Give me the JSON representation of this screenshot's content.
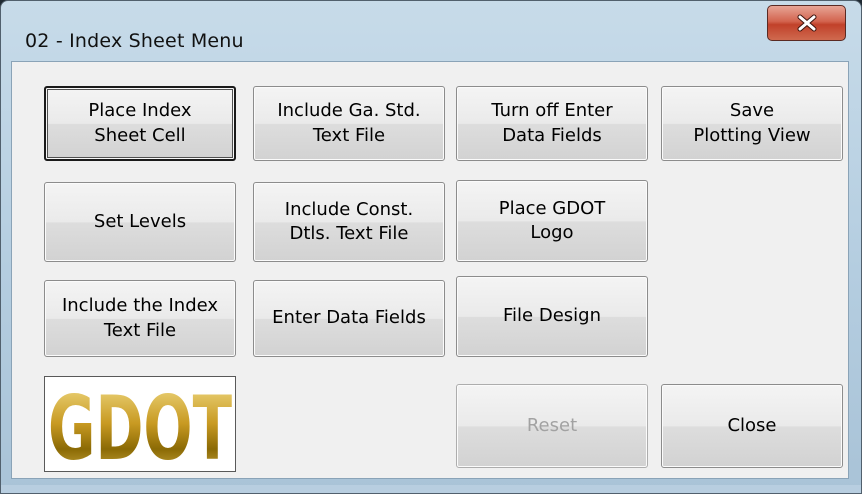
{
  "window": {
    "title": "02 - Index Sheet Menu",
    "close_icon": "close-x-icon",
    "accent_close": "#c9503a"
  },
  "buttons": {
    "place_index_sheet_cell": "Place Index\nSheet Cell",
    "include_ga_std_text_file": "Include Ga. Std.\nText File",
    "turn_off_enter_data_fields": "Turn off Enter\nData Fields",
    "save_plotting_view": "Save\nPlotting View",
    "set_levels": "Set Levels",
    "include_const_dtls_text_file": "Include Const.\nDtls. Text File",
    "place_gdot_logo": "Place GDOT\nLogo",
    "include_the_index_text_file": "Include the Index\nText File",
    "enter_data_fields": "Enter Data Fields",
    "file_design": "File Design",
    "reset": "Reset",
    "close": "Close"
  },
  "logo": {
    "text": "GDOT",
    "colors": [
      "#8b6a05",
      "#d6b23a",
      "#f3df8b"
    ]
  }
}
